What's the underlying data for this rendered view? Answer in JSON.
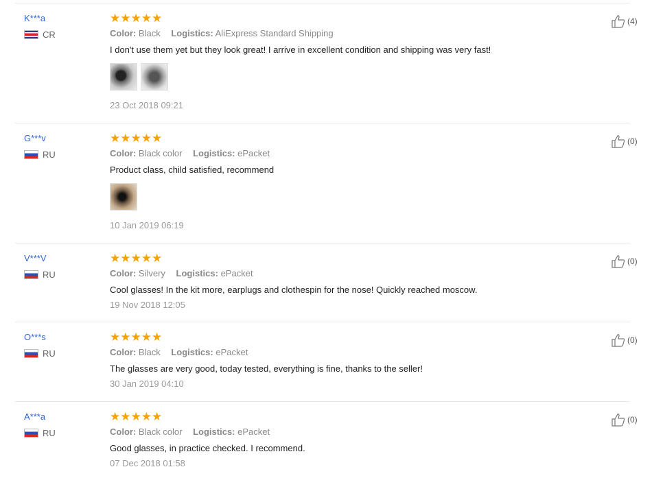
{
  "reviews": [
    {
      "user": "K***a",
      "country": "CR",
      "flag": "cr",
      "stars": "★★★★★",
      "color_label": "Color:",
      "color": "Black",
      "logistics_label": "Logistics:",
      "logistics": "AliExpress Standard Shipping",
      "text": "I don't use them yet but they look great! I arrive in excellent condition and shipping was very fast!",
      "photos": 2,
      "date": "23 Oct 2018 09:21",
      "likes": "(4)"
    },
    {
      "user": "G***v",
      "country": "RU",
      "flag": "ru",
      "stars": "★★★★★",
      "color_label": "Color:",
      "color": "Black color",
      "logistics_label": "Logistics:",
      "logistics": "ePacket",
      "text": "Product class, child satisfied, recommend",
      "photos": 1,
      "date": "10 Jan 2019 06:19",
      "likes": "(0)"
    },
    {
      "user": "V***V",
      "country": "RU",
      "flag": "ru",
      "stars": "★★★★★",
      "color_label": "Color:",
      "color": "Silvery",
      "logistics_label": "Logistics:",
      "logistics": "ePacket",
      "text": "Cool glasses! In the kit more, earplugs and clothespin for the nose! Quickly reached moscow.",
      "photos": 0,
      "date": "19 Nov 2018 12:05",
      "likes": "(0)"
    },
    {
      "user": "O***s",
      "country": "RU",
      "flag": "ru",
      "stars": "★★★★★",
      "color_label": "Color:",
      "color": "Black",
      "logistics_label": "Logistics:",
      "logistics": "ePacket",
      "text": "The glasses are very good, today tested, everything is fine, thanks to the seller!",
      "photos": 0,
      "date": "30 Jan 2019 04:10",
      "likes": "(0)"
    },
    {
      "user": "A***a",
      "country": "RU",
      "flag": "ru",
      "stars": "★★★★★",
      "color_label": "Color:",
      "color": "Black color",
      "logistics_label": "Logistics:",
      "logistics": "ePacket",
      "text": "Good glasses, in practice checked. I recommend.",
      "photos": 0,
      "date": "07 Dec 2018 01:58",
      "likes": "(0)"
    }
  ],
  "colors": {
    "username": "#3366cc",
    "star": "#f5a300",
    "divider": "#e8e8e8"
  }
}
